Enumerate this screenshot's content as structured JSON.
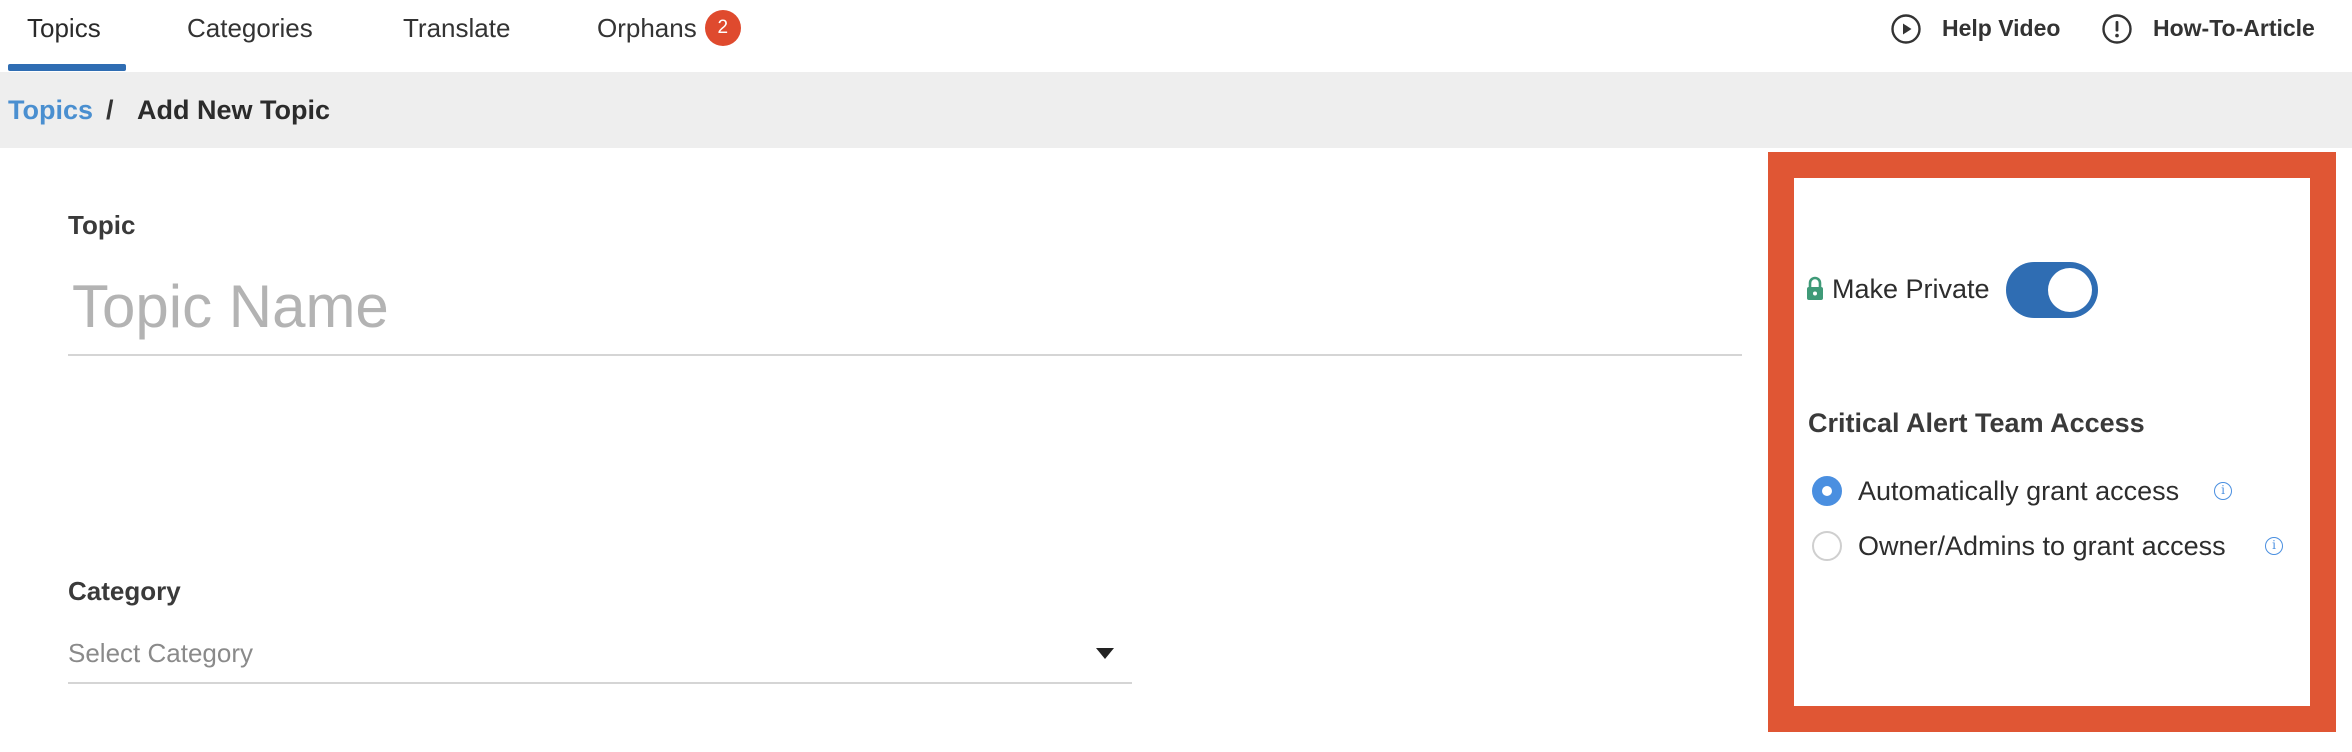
{
  "tabs": [
    {
      "label": "Topics",
      "active": true
    },
    {
      "label": "Categories",
      "active": false
    },
    {
      "label": "Translate",
      "active": false
    },
    {
      "label": "Orphans",
      "active": false,
      "badge": "2"
    }
  ],
  "help_links": [
    {
      "label": "Help Video",
      "icon": "play-circle-icon"
    },
    {
      "label": "How-To-Article",
      "icon": "exclamation-circle-icon"
    }
  ],
  "breadcrumb": {
    "parent": "Topics",
    "separator": "/",
    "current": "Add New Topic"
  },
  "form": {
    "topic_label": "Topic",
    "topic_placeholder": "Topic Name",
    "topic_value": "",
    "category_label": "Category",
    "category_placeholder": "Select Category"
  },
  "privacy_panel": {
    "make_private_label": "Make Private",
    "make_private_on": true,
    "alert_section_title": "Critical Alert Team Access",
    "options": [
      {
        "label": "Automatically grant access",
        "selected": true
      },
      {
        "label": "Owner/Admins to grant access",
        "selected": false
      }
    ]
  },
  "colors": {
    "accent_blue": "#2f6db3",
    "link_blue": "#4a8fd0",
    "badge_red": "#df4a2e",
    "highlight_border": "#e05634",
    "lock_green": "#3f9a78"
  }
}
